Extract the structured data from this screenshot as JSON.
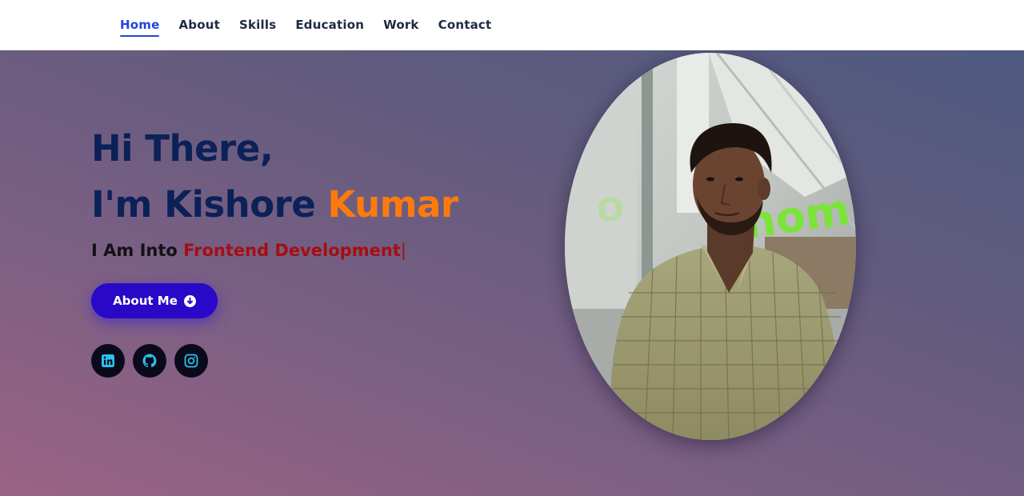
{
  "nav": {
    "items": [
      {
        "label": "Home",
        "active": true
      },
      {
        "label": "About",
        "active": false
      },
      {
        "label": "Skills",
        "active": false
      },
      {
        "label": "Education",
        "active": false
      },
      {
        "label": "Work",
        "active": false
      },
      {
        "label": "Contact",
        "active": false
      }
    ]
  },
  "hero": {
    "greeting_line1": "Hi There,",
    "greeting_line2_prefix": "I'm Kishore ",
    "greeting_line2_accent": "Kumar",
    "role_prefix": "I Am Into ",
    "role_typed": "Frontend Development",
    "role_cursor": "|",
    "about_button_label": "About Me",
    "socials": [
      {
        "icon": "linkedin-icon"
      },
      {
        "icon": "github-icon"
      },
      {
        "icon": "instagram-icon"
      }
    ],
    "photo_sign_text": "homi"
  },
  "colors": {
    "nav_active": "#2244e0",
    "greeting": "#0b2158",
    "accent": "#ff7a0d",
    "typed_role": "#a50e12",
    "button": "#2a08c8",
    "social_icon": "#2bc1ee"
  }
}
